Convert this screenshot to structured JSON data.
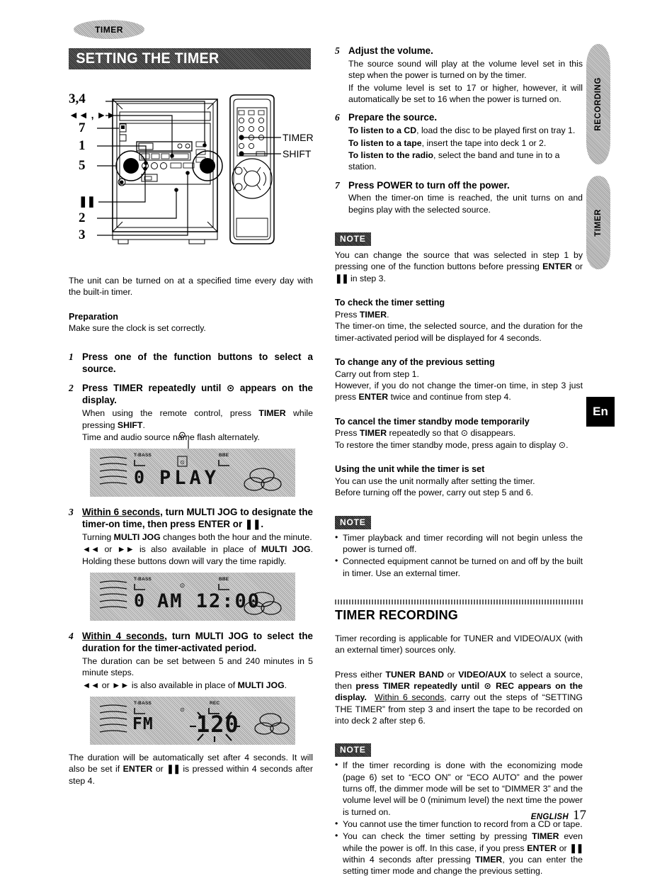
{
  "header": {
    "tab_label": "TIMER",
    "section_title": "SETTING THE TIMER"
  },
  "side_tabs": {
    "recording": "RECORDING",
    "timer": "TIMER",
    "language_badge": "En"
  },
  "diagram": {
    "labels": {
      "l34": "3,4",
      "lskip": "◄◄ , ►►",
      "l7": "7",
      "l1": "1",
      "l5": "5",
      "lpause": "❚❚",
      "l2": "2",
      "l3": "3",
      "remote_timer": "TIMER",
      "remote_shift": "SHIFT"
    }
  },
  "left": {
    "intro": "The unit can be turned on at a specified time every day with the built-in timer.",
    "preparation_heading": "Preparation",
    "preparation_text": "Make sure the clock is set correctly.",
    "steps": [
      {
        "num": "1",
        "title": "Press one of the function buttons to select a source.",
        "subs": []
      },
      {
        "num": "2",
        "title_a": "Press TIMER repeatedly until ",
        "title_b": " appears on the display.",
        "subs": [
          "When using the remote control, press TIMER while pressing SHIFT.",
          "Time and audio source name flash alternately."
        ]
      },
      {
        "num": "3",
        "title_pre": "Within 6 seconds",
        "title_post": ", turn MULTI JOG to designate the timer-on time, then press ENTER or ❚❚.",
        "subs": [
          "Turning MULTI JOG changes both the hour and the minute.",
          "◄◄ or ►► is also available in place of MULTI JOG. Holding these buttons down will vary the time rapidly."
        ]
      },
      {
        "num": "4",
        "title_pre": "Within 4 seconds",
        "title_post": ", turn MULTI JOG to select the duration for the timer-activated period.",
        "subs": [
          "The duration can be set between 5 and 240 minutes in 5 minute steps.",
          "◄◄ or ►► is also available in place of MULTI JOG."
        ]
      }
    ],
    "closing_text": "The duration will be automatically set after 4 seconds. It will also be set if ENTER or ❚❚ is pressed within 4 seconds after step 4.",
    "displays": [
      {
        "name": "display-play",
        "tbass": "T-BASS",
        "bbe": "BBE",
        "timer_icon": "clock-icon",
        "left_digit": "0",
        "main_text": "PLAY",
        "blinking": false
      },
      {
        "name": "display-clock",
        "tbass": "T-BASS",
        "bbe": "BBE",
        "timer_icon": "clock-icon",
        "left_digit": "0",
        "main_text": "AM 12:00",
        "blinking": false
      },
      {
        "name": "display-duration",
        "tbass": "T-BASS",
        "rec": "REC",
        "timer_icon": "clock-icon",
        "source_text": "FM",
        "main_text": "120",
        "blinking": true
      }
    ]
  },
  "right": {
    "steps": [
      {
        "num": "5",
        "title": "Adjust the volume.",
        "subs": [
          "The source sound will play at the volume level set in this step when the power is turned on by the timer.",
          "If the volume level is set to 17 or higher, however, it will automatically be set to 16 when the power is turned on."
        ]
      },
      {
        "num": "6",
        "title": "Prepare the source.",
        "subs_bold_lead": [
          {
            "lead": "To listen to a CD",
            "rest": ", load the disc to be played first on tray 1."
          },
          {
            "lead": "To listen to a tape",
            "rest": ", insert the tape into deck 1 or 2."
          },
          {
            "lead": "To listen to the radio",
            "rest": ", select the band and tune in to a station."
          }
        ]
      },
      {
        "num": "7",
        "title": "Press POWER to turn off the power.",
        "subs": [
          "When the timer-on time is reached, the unit turns on and begins play with the selected source."
        ]
      }
    ],
    "note1": {
      "badge": "NOTE",
      "text_a": "You can change the source that was selected in step 1 by pressing one of the function buttons before pressing ",
      "bold_enter": "ENTER",
      "text_or": " or ",
      "pause": "❚❚",
      "text_b": " in step 3."
    },
    "sections": [
      {
        "heading": "To check the timer setting",
        "lines": [
          "Press TIMER.",
          "The timer-on time, the selected source, and the duration for the timer-activated period will be displayed for 4 seconds."
        ]
      },
      {
        "heading": "To change any of the previous setting",
        "lines": [
          "Carry out from step 1.",
          "However, if you do not change the timer-on time, in step 3 just press ENTER twice and continue from step 4."
        ]
      },
      {
        "heading": "To cancel the timer standby mode temporarily",
        "lines": [
          "Press TIMER repeatedly so that ⊙ disappears.",
          "To restore the timer standby mode, press again to display ⊙."
        ]
      },
      {
        "heading": "Using the unit while the timer is set",
        "lines": [
          "You can use the unit normally after setting the timer.",
          "Before turning off the power, carry out step 5 and 6."
        ]
      }
    ],
    "note2": {
      "badge": "NOTE",
      "items": [
        "Timer playback and timer recording will not begin unless the power is turned off.",
        "Connected equipment cannot be turned on and off by the built in timer.  Use an external timer."
      ]
    },
    "timer_recording": {
      "heading": "TIMER RECORDING",
      "intro": "Timer recording is applicable for TUNER and VIDEO/AUX (with an external timer) sources only.",
      "instruction_1": "Press either ",
      "instruction_b1": "TUNER BAND",
      "instruction_2": " or ",
      "instruction_b2": "VIDEO/AUX",
      "instruction_3": " to select a source, then ",
      "instruction_b3": "press TIMER repeatedly until",
      "instruction_b4": "REC appears on the display.",
      "instruction_u": "Within 6 seconds",
      "instruction_4": ", carry out the steps of “SETTING THE TIMER” from step 3 and insert the tape to be recorded on into deck 2 after step 6."
    },
    "note3": {
      "badge": "NOTE",
      "items": [
        "If the timer recording is done with the economizing mode (page 6) set to “ECO ON” or “ECO AUTO” and the power turns off, the dimmer mode will be set to “DIMMER 3” and the volume level will be 0 (minimum level) the next time the power is turned on.",
        "You cannot use the timer function to record from a CD or tape.",
        "You can check the timer setting by pressing TIMER even while the power is off. In this case, if you press ENTER or ❚❚ within 4 seconds after pressing TIMER, you can enter the setting timer mode and change the previous setting."
      ]
    }
  },
  "footer": {
    "language": "ENGLISH",
    "page_number": "17"
  }
}
